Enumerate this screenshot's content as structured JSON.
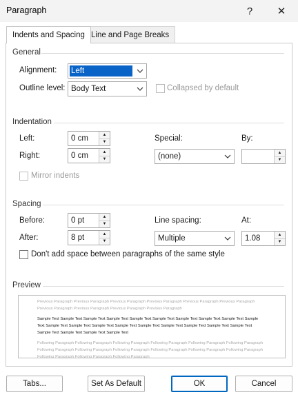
{
  "window": {
    "title": "Paragraph",
    "help_glyph": "?",
    "close_glyph": "✕"
  },
  "tabs": [
    {
      "label": "Indents and Spacing",
      "active": true
    },
    {
      "label": "Line and Page Breaks",
      "active": false
    }
  ],
  "general": {
    "heading": "General",
    "alignment_label": "Alignment:",
    "alignment_value": "Left",
    "outline_label": "Outline level:",
    "outline_value": "Body Text",
    "collapsed_label": "Collapsed by default",
    "collapsed_checked": false
  },
  "indentation": {
    "heading": "Indentation",
    "left_label": "Left:",
    "left_value": "0 cm",
    "right_label": "Right:",
    "right_value": "0 cm",
    "special_label": "Special:",
    "special_value": "(none)",
    "by_label": "By:",
    "by_value": "",
    "mirror_label": "Mirror indents",
    "mirror_checked": false
  },
  "spacing": {
    "heading": "Spacing",
    "before_label": "Before:",
    "before_value": "0 pt",
    "after_label": "After:",
    "after_value": "8 pt",
    "line_spacing_label": "Line spacing:",
    "line_spacing_value": "Multiple",
    "at_label": "At:",
    "at_value": "1.08",
    "dont_add_label": "Don't add space between paragraphs of the same style",
    "dont_add_checked": false
  },
  "preview": {
    "heading": "Preview",
    "previous_text": "Previous Paragraph Previous Paragraph Previous Paragraph Previous Paragraph Previous Paragraph Previous Paragraph Previous Paragraph Previous Paragraph Previous Paragraph Previous Paragraph",
    "sample_text": "Sample Text Sample Text Sample Text Sample Text Sample Text Sample Text Sample Text Sample Text Sample Text Sample Text Sample Text Sample Text Sample Text Sample Text Sample Text Sample Text Sample Text Sample Text Sample Text Sample Text Sample Text Sample Text Sample Text",
    "following_text": "Following Paragraph Following Paragraph Following Paragraph Following Paragraph Following Paragraph Following Paragraph Following Paragraph Following Paragraph Following Paragraph Following Paragraph Following Paragraph Following Paragraph Following Paragraph Following Paragraph Following Paragraph"
  },
  "buttons": {
    "tabs": "Tabs...",
    "set_default": "Set As Default",
    "ok": "OK",
    "cancel": "Cancel"
  },
  "icons": {
    "dropdown": "chevron-down-icon",
    "spin": "spinner-arrows-icon"
  },
  "colors": {
    "selection": "#0a64c8",
    "default_button_border": "#0067c0"
  }
}
